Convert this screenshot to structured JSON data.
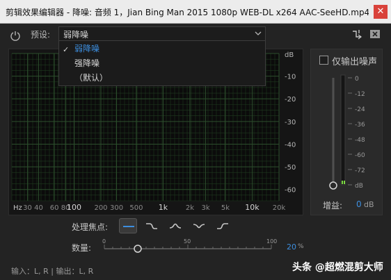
{
  "window": {
    "title": "剪辑效果编辑器 - 降噪: 音频 1，Jian Bing Man 2015 1080p WEB-DL x264 AAC-SeeHD.mp4...",
    "close_glyph": "✕"
  },
  "preset": {
    "label": "预设:",
    "value": "弱降噪",
    "options": [
      "弱降噪",
      "强降噪",
      "（默认）"
    ],
    "selected_index": 0
  },
  "chart_data": {
    "type": "line",
    "title": "",
    "xlabel": "Hz",
    "ylabel": "dB",
    "x_scale": "log",
    "xlim": [
      20,
      20000
    ],
    "ylim": [
      -65,
      0
    ],
    "x_ticks": [
      {
        "value": 30,
        "label": "30"
      },
      {
        "value": 40,
        "label": "40"
      },
      {
        "value": 60,
        "label": "60"
      },
      {
        "value": 80,
        "label": "80"
      },
      {
        "value": 100,
        "label": "100"
      },
      {
        "value": 200,
        "label": "200"
      },
      {
        "value": 300,
        "label": "300"
      },
      {
        "value": 500,
        "label": "500"
      },
      {
        "value": 1000,
        "label": "1k"
      },
      {
        "value": 2000,
        "label": "2k"
      },
      {
        "value": 3000,
        "label": "3k"
      },
      {
        "value": 5000,
        "label": "5k"
      },
      {
        "value": 10000,
        "label": "10k"
      },
      {
        "value": 20000,
        "label": "20k"
      }
    ],
    "y_ticks": [
      {
        "value": 0,
        "label": "dB"
      },
      {
        "value": -10,
        "label": "-10"
      },
      {
        "value": -20,
        "label": "-20"
      },
      {
        "value": -30,
        "label": "-30"
      },
      {
        "value": -40,
        "label": "-40"
      },
      {
        "value": -50,
        "label": "-50"
      },
      {
        "value": -60,
        "label": "-60"
      }
    ],
    "grid": true,
    "series": []
  },
  "output_noise": {
    "label": "仅输出噪声",
    "checked": false
  },
  "meter": {
    "ticks": [
      "0",
      "-12",
      "-24",
      "-36",
      "-48",
      "-60",
      "-72",
      "dB"
    ],
    "level_color": "#7bd843"
  },
  "gain": {
    "label": "增益:",
    "value": "0",
    "unit": "dB"
  },
  "processing_focus": {
    "label": "处理焦点:",
    "options": [
      "flat-focus-icon",
      "low-focus-icon",
      "mid-focus-icon",
      "notch-focus-icon",
      "high-focus-icon"
    ],
    "selected_index": 0
  },
  "amount": {
    "label": "数量:",
    "value": "20",
    "unit": "%",
    "fraction": 0.2,
    "ticks": [
      "0",
      "50",
      "100"
    ]
  },
  "status": {
    "io": "输入：L, R | 输出：L, R"
  },
  "watermark": {
    "text": "头条 @超燃混剪大师"
  },
  "colors": {
    "accent": "#3d8fe0",
    "close": "#d9423a",
    "grid": "#1f3a1f"
  }
}
